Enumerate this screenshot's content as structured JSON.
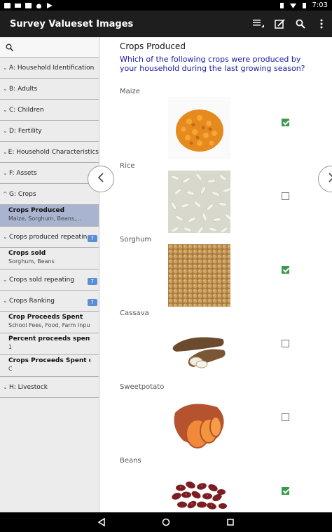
{
  "status_bar": {
    "time": "7:03"
  },
  "app_bar": {
    "title": "Survey Valueset Images",
    "actions": [
      "list-icon",
      "edit-icon",
      "search-icon",
      "overflow-menu-icon"
    ]
  },
  "sidebar": {
    "sections_top": [
      {
        "label": "A: Household Identification"
      },
      {
        "label": "B: Adults"
      },
      {
        "label": "C: Children"
      },
      {
        "label": "D: Fertility"
      },
      {
        "label": "E: Household Characteristics"
      },
      {
        "label": "F: Assets"
      },
      {
        "label": "G: Crops"
      }
    ],
    "crops_produced": {
      "title": "Crops Produced",
      "subtitle": "Maize, Sorghum, Beans,..."
    },
    "crops_produced_repeating": {
      "label": "Crops produced repeatin",
      "badge": "7"
    },
    "crops_sold": {
      "title": "Crops sold",
      "subtitle": "Sorghum, Beans"
    },
    "crops_sold_repeating": {
      "label": "Crops sold repeating",
      "badge": "7"
    },
    "crops_ranking": {
      "label": "Crops Ranking",
      "badge": "7"
    },
    "crop_proceeds_spent": {
      "title": "Crop Proceeds Spent",
      "subtitle": "School Fees, Food, Farm Inputs"
    },
    "percent_proceeds": {
      "title": "Percent proceeds spent on...",
      "subtitle": "1"
    },
    "crops_proceeds_spent_on": {
      "title": "Crops Proceeds Spent on...",
      "subtitle": "C"
    },
    "livestock": {
      "label": "H: Livestock"
    }
  },
  "main": {
    "title": "Crops Produced",
    "question": "Which of the following crops were produced by your household during the last growing season?",
    "crops": [
      {
        "label": "Maize",
        "checked": true
      },
      {
        "label": "Rice",
        "checked": false
      },
      {
        "label": "Sorghum",
        "checked": true
      },
      {
        "label": "Cassava",
        "checked": false
      },
      {
        "label": "Sweetpotato",
        "checked": false
      },
      {
        "label": "Beans",
        "checked": true
      }
    ]
  }
}
